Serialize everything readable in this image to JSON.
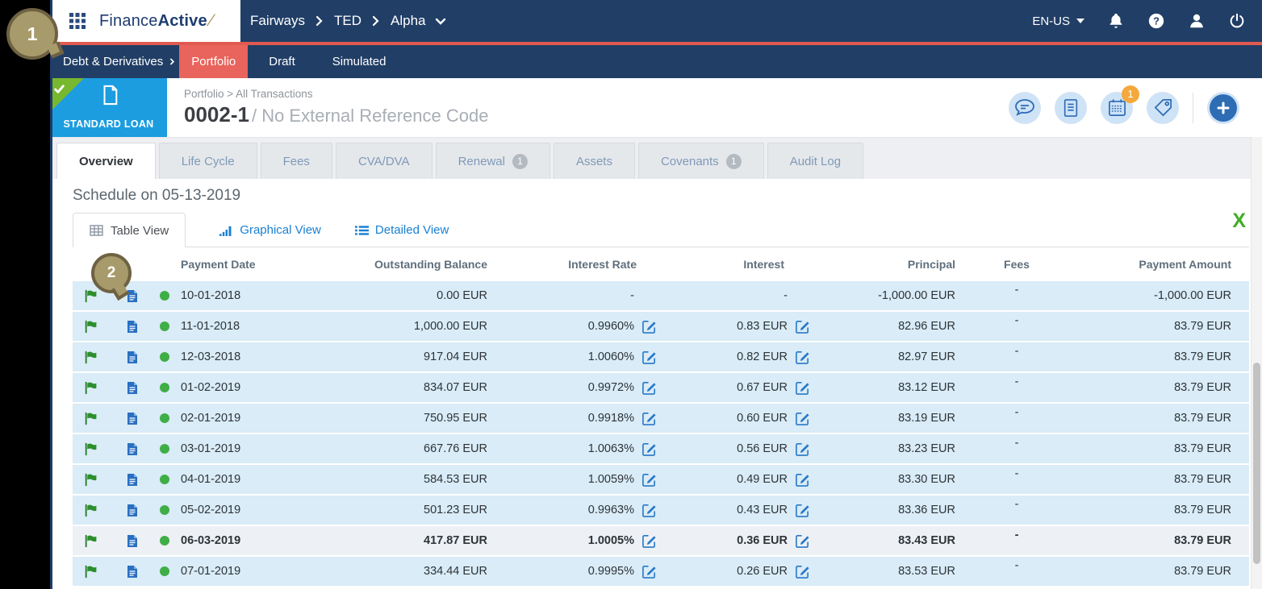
{
  "callouts": {
    "step1": "1",
    "step2": "2"
  },
  "navbar": {
    "brand_regular": "Finance",
    "brand_bold": "Active",
    "brand_slash": "/",
    "breadcrumb": [
      "Fairways",
      "TED",
      "Alpha"
    ],
    "locale": "EN-US"
  },
  "subnav": {
    "menu_label": "Debt & Derivatives",
    "tabs": [
      {
        "label": "Portfolio",
        "active": true
      },
      {
        "label": "Draft",
        "active": false
      },
      {
        "label": "Simulated",
        "active": false
      }
    ]
  },
  "loan_header": {
    "type_badge": "STANDARD LOAN",
    "breadcrumb": "Portfolio > All Transactions",
    "deal_id": "0002-1",
    "deal_subtitle": "/ No External Reference Code",
    "calendar_badge": "1"
  },
  "tabs": [
    {
      "label": "Overview",
      "active": true
    },
    {
      "label": "Life Cycle",
      "active": false
    },
    {
      "label": "Fees",
      "active": false
    },
    {
      "label": "CVA/DVA",
      "active": false
    },
    {
      "label": "Renewal",
      "badge": "1",
      "active": false
    },
    {
      "label": "Assets",
      "active": false
    },
    {
      "label": "Covenants",
      "badge": "1",
      "active": false
    },
    {
      "label": "Audit Log",
      "active": false
    }
  ],
  "schedule": {
    "title": "Schedule on 05-13-2019",
    "views": [
      {
        "label": "Table View",
        "active": true
      },
      {
        "label": "Graphical View",
        "active": false
      },
      {
        "label": "Detailed View",
        "active": false
      }
    ]
  },
  "table": {
    "columns": [
      "Payment Date",
      "Outstanding Balance",
      "Interest Rate",
      "Interest",
      "Principal",
      "Fees",
      "Payment Amount"
    ],
    "rows": [
      {
        "date": "10-01-2018",
        "balance": "0.00 EUR",
        "rate": "-",
        "interest": "-",
        "principal": "-1,000.00 EUR",
        "fees": "-",
        "amount": "-1,000.00 EUR",
        "editable": false,
        "highlight": false
      },
      {
        "date": "11-01-2018",
        "balance": "1,000.00 EUR",
        "rate": "0.9960%",
        "interest": "0.83 EUR",
        "principal": "82.96 EUR",
        "fees": "-",
        "amount": "83.79 EUR",
        "editable": true,
        "highlight": false
      },
      {
        "date": "12-03-2018",
        "balance": "917.04 EUR",
        "rate": "1.0060%",
        "interest": "0.82 EUR",
        "principal": "82.97 EUR",
        "fees": "-",
        "amount": "83.79 EUR",
        "editable": true,
        "highlight": false
      },
      {
        "date": "01-02-2019",
        "balance": "834.07 EUR",
        "rate": "0.9972%",
        "interest": "0.67 EUR",
        "principal": "83.12 EUR",
        "fees": "-",
        "amount": "83.79 EUR",
        "editable": true,
        "highlight": false
      },
      {
        "date": "02-01-2019",
        "balance": "750.95 EUR",
        "rate": "0.9918%",
        "interest": "0.60 EUR",
        "principal": "83.19 EUR",
        "fees": "-",
        "amount": "83.79 EUR",
        "editable": true,
        "highlight": false
      },
      {
        "date": "03-01-2019",
        "balance": "667.76 EUR",
        "rate": "1.0063%",
        "interest": "0.56 EUR",
        "principal": "83.23 EUR",
        "fees": "-",
        "amount": "83.79 EUR",
        "editable": true,
        "highlight": false
      },
      {
        "date": "04-01-2019",
        "balance": "584.53 EUR",
        "rate": "1.0059%",
        "interest": "0.49 EUR",
        "principal": "83.30 EUR",
        "fees": "-",
        "amount": "83.79 EUR",
        "editable": true,
        "highlight": false
      },
      {
        "date": "05-02-2019",
        "balance": "501.23 EUR",
        "rate": "0.9963%",
        "interest": "0.43 EUR",
        "principal": "83.36 EUR",
        "fees": "-",
        "amount": "83.79 EUR",
        "editable": true,
        "highlight": false
      },
      {
        "date": "06-03-2019",
        "balance": "417.87 EUR",
        "rate": "1.0005%",
        "interest": "0.36 EUR",
        "principal": "83.43 EUR",
        "fees": "-",
        "amount": "83.79 EUR",
        "editable": true,
        "highlight": true
      },
      {
        "date": "07-01-2019",
        "balance": "334.44 EUR",
        "rate": "0.9995%",
        "interest": "0.26 EUR",
        "principal": "83.53 EUR",
        "fees": "-",
        "amount": "83.79 EUR",
        "editable": true,
        "highlight": false
      }
    ]
  },
  "colors": {
    "navy": "#213e66",
    "accent_red": "#e05a50",
    "active_tab_red": "#e8645c",
    "loan_blue": "#1b9de0",
    "ribbon_green": "#77b82e",
    "link_blue": "#1a80d2",
    "row_blue": "#d9ecf7",
    "highlight_row": "#edf1f6"
  }
}
